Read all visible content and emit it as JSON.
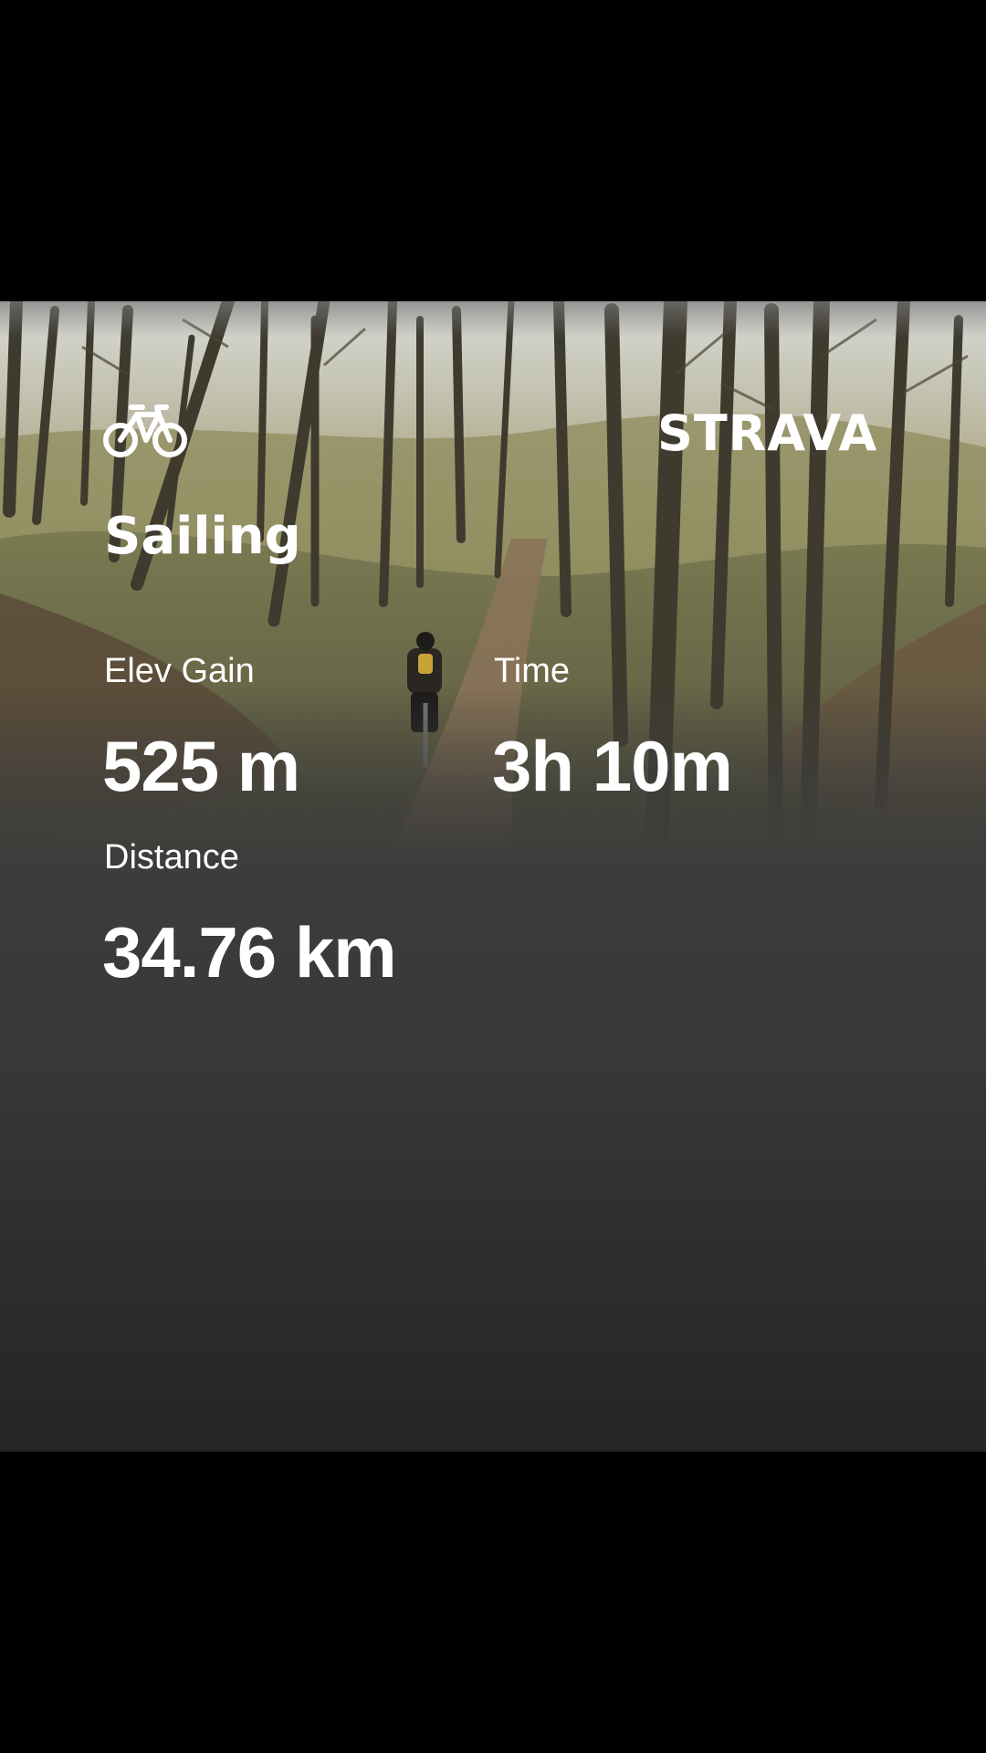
{
  "activity": {
    "icon": "bicycle-icon",
    "title": "Sailing"
  },
  "brand": {
    "name": "STRAVA"
  },
  "stats": [
    {
      "label": "Elev Gain",
      "value": "525 m"
    },
    {
      "label": "Time",
      "value": "3h 10m"
    },
    {
      "label": "Distance",
      "value": "34.76 km"
    }
  ],
  "colors": {
    "background": "#000000",
    "card_bottom": "#252524",
    "text": "#ffffff"
  }
}
